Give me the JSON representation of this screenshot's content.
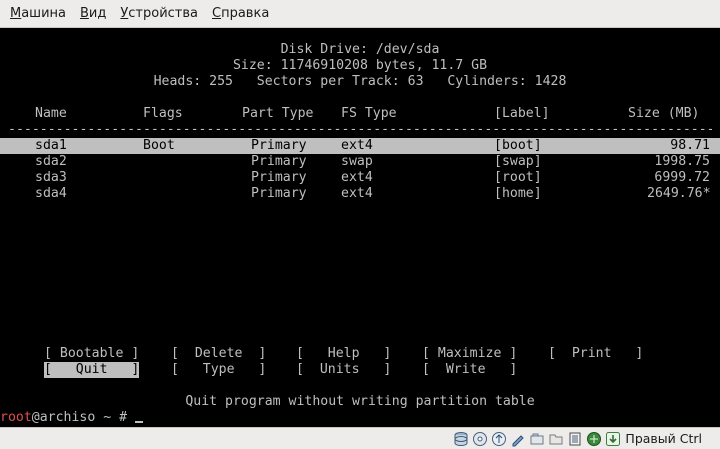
{
  "menubar": {
    "items": [
      {
        "label": "Машина"
      },
      {
        "label": "Вид"
      },
      {
        "label": "Устройства"
      },
      {
        "label": "Справка"
      }
    ]
  },
  "header": {
    "line1": "Disk Drive: /dev/sda",
    "line2": "Size: 11746910208 bytes, 11.7 GB",
    "line3": "Heads: 255   Sectors per Track: 63   Cylinders: 1428"
  },
  "table": {
    "columns": {
      "name": "Name",
      "flags": "Flags",
      "part_type": "Part Type",
      "fs_type": "FS Type",
      "label": "[Label]",
      "size": "Size (MB)"
    },
    "separator": "-----------------------------------------------------------------------------------------",
    "rows": [
      {
        "name": "sda1",
        "flags": "Boot",
        "part_type": "Primary",
        "fs_type": "ext4",
        "label": "[boot]",
        "size": "98.71",
        "selected": true
      },
      {
        "name": "sda2",
        "flags": "",
        "part_type": "Primary",
        "fs_type": "swap",
        "label": "[swap]",
        "size": "1998.75",
        "selected": false
      },
      {
        "name": "sda3",
        "flags": "",
        "part_type": "Primary",
        "fs_type": "ext4",
        "label": "[root]",
        "size": "6999.72",
        "selected": false
      },
      {
        "name": "sda4",
        "flags": "",
        "part_type": "Primary",
        "fs_type": "ext4",
        "label": "[home]",
        "size": "2649.76*",
        "selected": false
      }
    ]
  },
  "menu": {
    "bootable": "[ Bootable ]",
    "delete": "[  Delete  ]",
    "help": "[   Help   ]",
    "maximize": "[ Maximize ]",
    "print": "[  Print   ]",
    "quit": "[   Quit   ]",
    "type": "[   Type   ]",
    "units": "[  Units   ]",
    "write": "[  Write   ]"
  },
  "hint": "Quit program without writing partition table",
  "prompt": {
    "user": "root",
    "rest": "@archiso ~ # "
  },
  "statusbar": {
    "icons": [
      "hdd-icon",
      "cd-icon",
      "usb-icon",
      "shared-folder-icon",
      "folder-icon",
      "display-icon",
      "vrdp-icon",
      "network-icon",
      "host-key-arrow-icon"
    ],
    "host_key": "Правый Ctrl"
  }
}
